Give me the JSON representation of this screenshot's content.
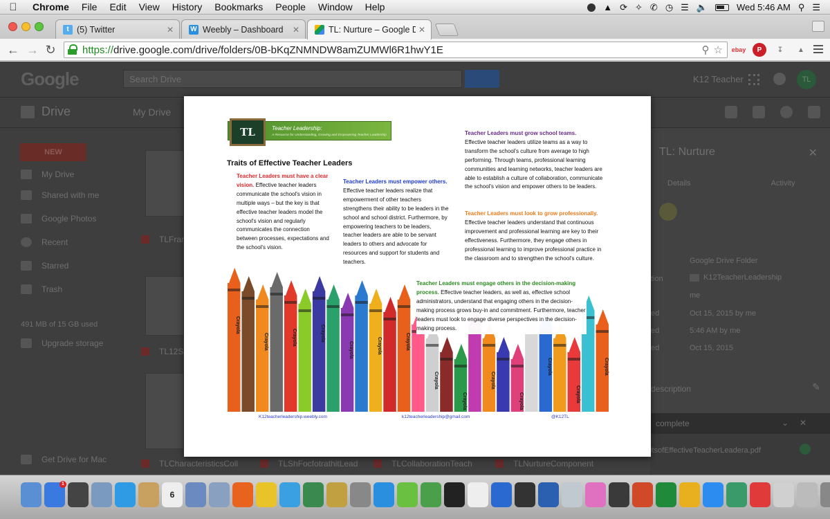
{
  "menubar": {
    "app_name": "Chrome",
    "items": [
      "File",
      "Edit",
      "View",
      "History",
      "Bookmarks",
      "People",
      "Window",
      "Help"
    ],
    "clock": "Wed 5:46 AM"
  },
  "tabs": [
    {
      "label": "(5) Twitter",
      "favicon": "twitter-bird",
      "color": "#55acee"
    },
    {
      "label": "Weebly – Dashboard",
      "favicon": "W",
      "color": "#2b8fe0"
    },
    {
      "label": "TL: Nurture – Google Drive",
      "favicon": "drive",
      "color": "#f4b400",
      "active": true
    }
  ],
  "addressbar": {
    "url_scheme": "https://",
    "url_rest": "drive.google.com/drive/folders/0B-bKqZNMNDW8amZUMWl6R1hwY1E"
  },
  "extensions": [
    "ebay",
    "pinterest",
    "download",
    "drive"
  ],
  "drive": {
    "logo": "Google",
    "search_placeholder": "Search Drive",
    "user": "K12 Teacher",
    "avatar_text": "TL",
    "section": "Drive",
    "breadcrumb": "My Drive",
    "new_button": "NEW",
    "nav": [
      "My Drive",
      "Shared with me",
      "Google Photos",
      "Recent",
      "Starred",
      "Trash"
    ],
    "storage": "491 MB of 15 GB used",
    "upgrade": "Upgrade storage",
    "get_drive": "Get Drive for Mac",
    "files": [
      "TLFram",
      "TL12S",
      "TLCharacteristicsColl",
      "TLShFocfotrathitLead",
      "TLCollaborationTeach",
      "TLNurtureComponent"
    ],
    "details": {
      "title": "TL: Nurture",
      "tab_details": "Details",
      "tab_activity": "Activity",
      "type": "Google Drive Folder",
      "location_label": "tion",
      "location": "K12TeacherLeadership",
      "owner": "me",
      "modified_label": "ed",
      "modified": "Oct 15, 2015 by me",
      "opened_label": "ed",
      "opened": "5:46 AM by me",
      "created_label": "ed",
      "created": "Oct 15, 2015",
      "description": "description"
    },
    "upload": {
      "header": "complete",
      "file": "itsofEffectiveTeacherLeadera.pdf"
    }
  },
  "document": {
    "banner_title": "Teacher Leadership:",
    "banner_subtitle": "A Resource for Understanding, Growing and Empowering Teacher Leadership",
    "chalkboard": "TL",
    "title": "Traits of Effective Teacher Leaders",
    "p1_head": "Teacher Leaders must have a clear vision.",
    "p1_body": "Effective teacher leaders communicate the school's vision in multiple ways – but the key is that effective teacher leaders model the school's vision and regularly communicates the connection between processes, expectations and the school's vision.",
    "p2_head": "Teacher Leaders must empower others.",
    "p2_body": "Effective teacher leaders realize that empowerment of other teachers strengthens their ability to be leaders in the school and school district. Furthermore, by empowering teachers to be leaders, teacher leaders are able to be servant leaders to others and advocate for resources and support for students and teachers.",
    "p3_head": "Teacher Leaders must grow school teams.",
    "p3_body": "Effective teacher leaders utilize teams as a way to transform the school's culture from average to high performing. Through teams, professional learning communities and learning networks, teacher leaders are able to establish a culture of collaboration, communicate the school's vision and empower others to be leaders.",
    "p4_head": "Teacher Leaders must look to grow professionally.",
    "p4_body": "Effective teacher leaders understand that continuous improvement and professional learning are key to their effectiveness. Furthermore, they engage others in professional learning to improve professional practice in the classroom and to strengthen the school's culture.",
    "p5_head": "Teacher Leaders must engage others in the decision-making process.",
    "p5_body": "Effective teacher leaders, as well as, effective school administrators, understand that engaging others in the decision-making process grows buy-in and commitment. Furthermore, teacher leaders must look to engage diverse perspectives in the decision-making process.",
    "footer": [
      "K12teacherleadership.weebly.com",
      "k12teacherleadership@gmail.com",
      "@K12TL"
    ],
    "crayon_label": "Crayola"
  },
  "dock": {
    "apps": [
      "finder",
      "app-store",
      "dashboard",
      "preview",
      "safari",
      "contacts",
      "calendar",
      "photos",
      "iphoto",
      "firefox",
      "chrome",
      "itunes",
      "time-machine",
      "imovie",
      "system-preferences",
      "weebly",
      "mindmap",
      "numbers",
      "puzzle",
      "crossword",
      "keynote",
      "nx2",
      "word",
      "maps",
      "pink-app",
      "camera",
      "powerpoint",
      "excel",
      "outlook",
      "zoom",
      "earth",
      "colors",
      "scanner",
      "tablet",
      "trash"
    ],
    "calendar_day": "6",
    "badge": "1",
    "colors": [
      "#5a8fd4",
      "#3a7ae0",
      "#444",
      "#7a9ac0",
      "#2f9be4",
      "#c8a060",
      "#eee",
      "#6a8ac0",
      "#8aa0c0",
      "#e8641e",
      "#e8c42a",
      "#3aa0e0",
      "#3a8a50",
      "#c0a040",
      "#888",
      "#2b8fe0",
      "#6ac040",
      "#4aa04a",
      "#222",
      "#eee",
      "#2a6ad0",
      "#333",
      "#2b5fb0",
      "#c0c8d0",
      "#e070c0",
      "#3a3a3a",
      "#d04a2a",
      "#1f8a3a",
      "#e8b01e",
      "#2d8cf0",
      "#3a9a6a",
      "#e03a3a",
      "#d0d0d0",
      "#bbb",
      "#888"
    ]
  }
}
